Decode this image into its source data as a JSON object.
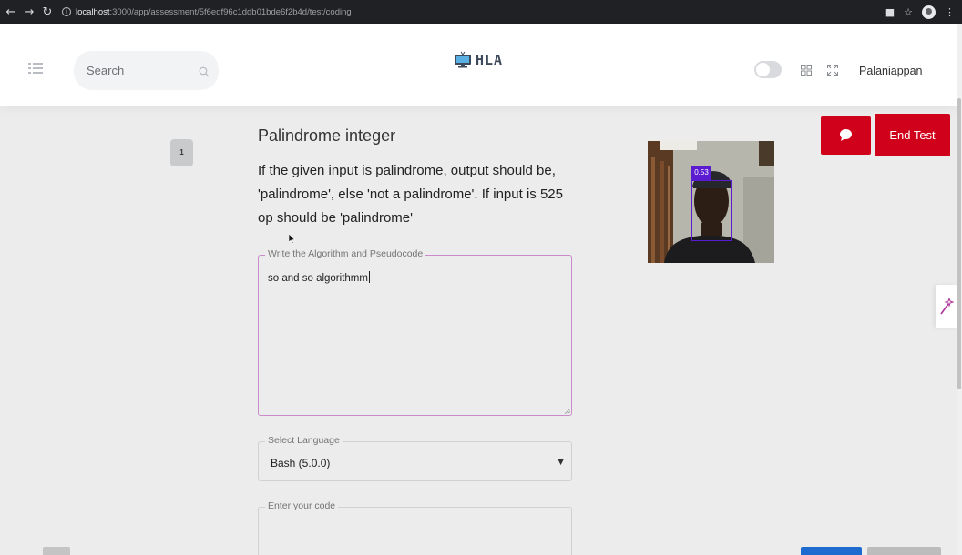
{
  "browser": {
    "url_host": "localhost",
    "url_path": ":3000/app/assessment/5f6edf96c1ddb01bde6f2b4d/test/coding"
  },
  "header": {
    "search_label": "Search",
    "logo_text": "HLA",
    "user_name": "Palaniappan"
  },
  "question": {
    "number": "1",
    "title": "Palindrome integer",
    "description": "If the given input is palindrome, output should be, 'palindrome', else 'not a palindrome'. If input is 525 op should be 'palindrome'"
  },
  "form": {
    "algorithm_legend": "Write the Algorithm and Pseudocode",
    "algorithm_value": "so and so algorithmm",
    "language_legend": "Select Language",
    "language_value": "Bash (5.0.0)",
    "code_legend": "Enter your code"
  },
  "webcam": {
    "face_label": "0.53"
  },
  "actions": {
    "end_test_label": "End Test"
  },
  "colors": {
    "accent_red": "#d0021b",
    "detection_purple": "#5a1bd1",
    "focus_border": "#c98bc9"
  }
}
